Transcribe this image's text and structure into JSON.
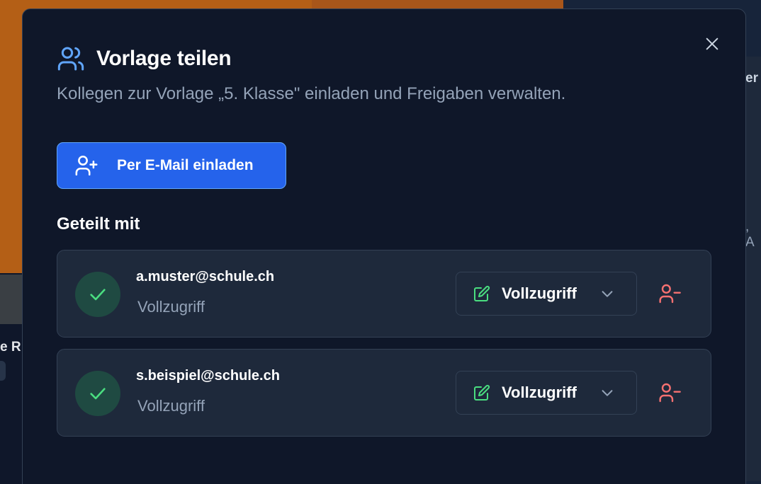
{
  "modal": {
    "title": "Vorlage teilen",
    "subtitle": "Kollegen zur Vorlage „5. Klasse\" einladen und Freigaben verwalten.",
    "invite_button_label": "Per E-Mail einladen",
    "section_title": "Geteilt mit",
    "shares": [
      {
        "email": "a.muster@schule.ch",
        "role": "Vollzugriff",
        "selected_role": "Vollzugriff"
      },
      {
        "email": "s.beispiel@schule.ch",
        "role": "Vollzugriff",
        "selected_role": "Vollzugriff"
      }
    ]
  },
  "background": {
    "left_text": "e R",
    "right_text_1": "er",
    "right_text_2": ", A"
  },
  "icons": {
    "title": "users-icon",
    "close": "close-icon",
    "invite": "user-plus-icon",
    "status": "check-icon",
    "role": "edit-icon",
    "dropdown": "chevron-down-icon",
    "remove": "user-minus-icon"
  },
  "colors": {
    "accent": "#2563eb",
    "success": "#4ade80",
    "danger": "#f87171",
    "title_icon": "#60a5fa"
  }
}
